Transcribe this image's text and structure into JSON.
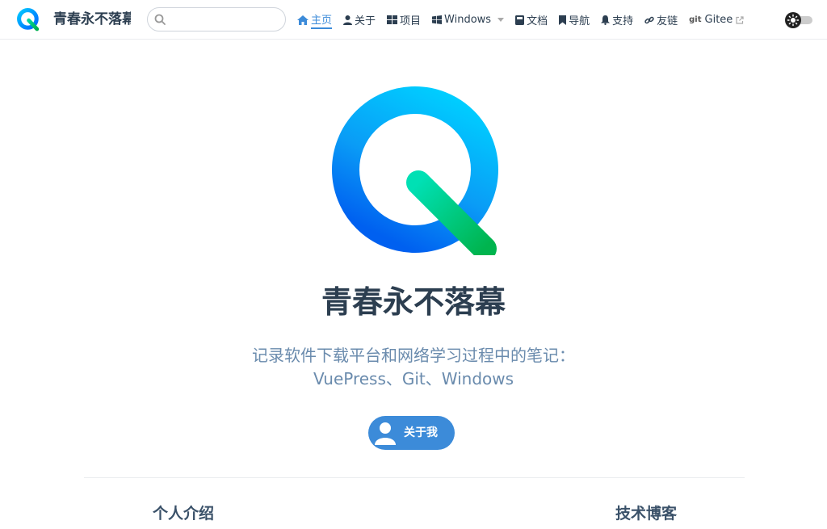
{
  "brand": {
    "title": "青春永不落幕",
    "logo_icon": "q-logo-icon"
  },
  "search": {
    "placeholder": "",
    "value": ""
  },
  "nav": {
    "items": [
      {
        "label": "主页",
        "icon": "home-icon",
        "active": true
      },
      {
        "label": "关于",
        "icon": "user-icon"
      },
      {
        "label": "项目",
        "icon": "grid-icon"
      },
      {
        "label": "Windows",
        "icon": "windows-icon",
        "dropdown": true
      },
      {
        "label": "文档",
        "icon": "book-icon"
      },
      {
        "label": "导航",
        "icon": "bookmark-icon"
      },
      {
        "label": "支持",
        "icon": "bell-icon"
      },
      {
        "label": "友链",
        "icon": "link-icon"
      },
      {
        "label": "Gitee",
        "prefix": "git",
        "icon": "external-link-icon"
      }
    ]
  },
  "hero": {
    "title": "青春永不落幕",
    "description_line1": "记录软件下载平台和网络学习过程中的笔记：",
    "description_line2": "VuePress、Git、Windows",
    "button_label": "关于我"
  },
  "features": [
    {
      "title": "个人介绍"
    },
    {
      "title": "技术博客"
    }
  ],
  "colors": {
    "accent": "#3c8bd9",
    "text": "#2c3e50",
    "description": "#6a8bad",
    "logo_blue_light": "#00c8ff",
    "logo_blue_dark": "#0066ff",
    "logo_green": "#00c16a"
  }
}
